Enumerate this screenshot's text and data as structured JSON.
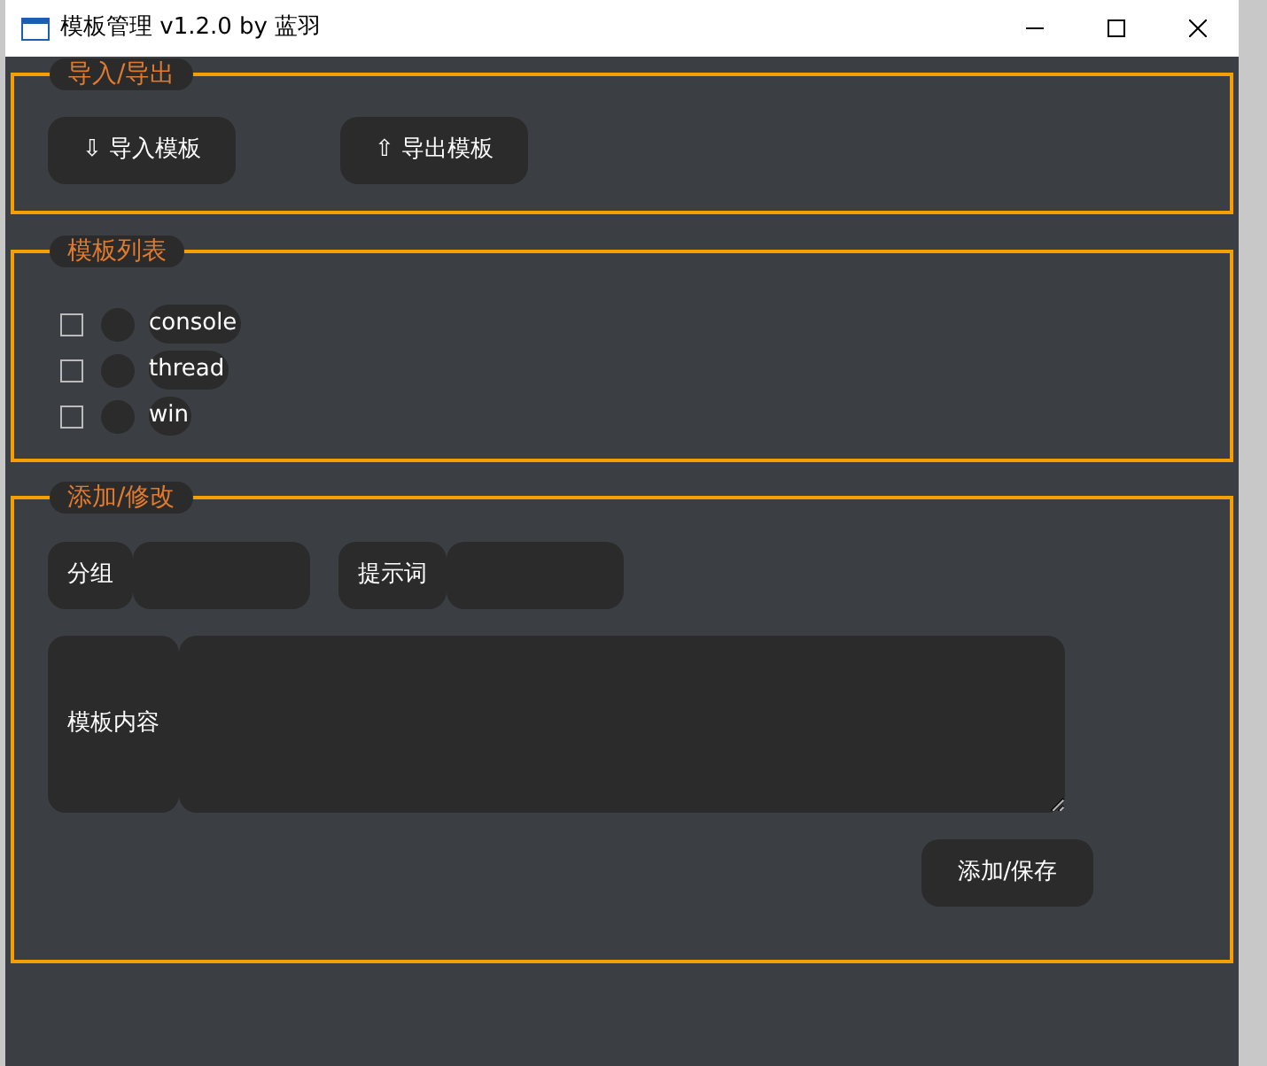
{
  "window": {
    "title": "模板管理 v1.2.0 by 蓝羽"
  },
  "import_export": {
    "legend": "导入/导出",
    "buttons": [
      "⇩ 导入模板",
      "⇧ 导出模板"
    ]
  },
  "template_list": {
    "legend": "模板列表",
    "items": [
      {
        "label": "console",
        "checked": false
      },
      {
        "label": "thread",
        "checked": false
      },
      {
        "label": "win",
        "checked": false
      }
    ]
  },
  "edit": {
    "legend": "添加/修改",
    "group_label": "分组",
    "keyword_label": "提示词",
    "content_label": "模板内容",
    "submit": "添加/保存"
  }
}
